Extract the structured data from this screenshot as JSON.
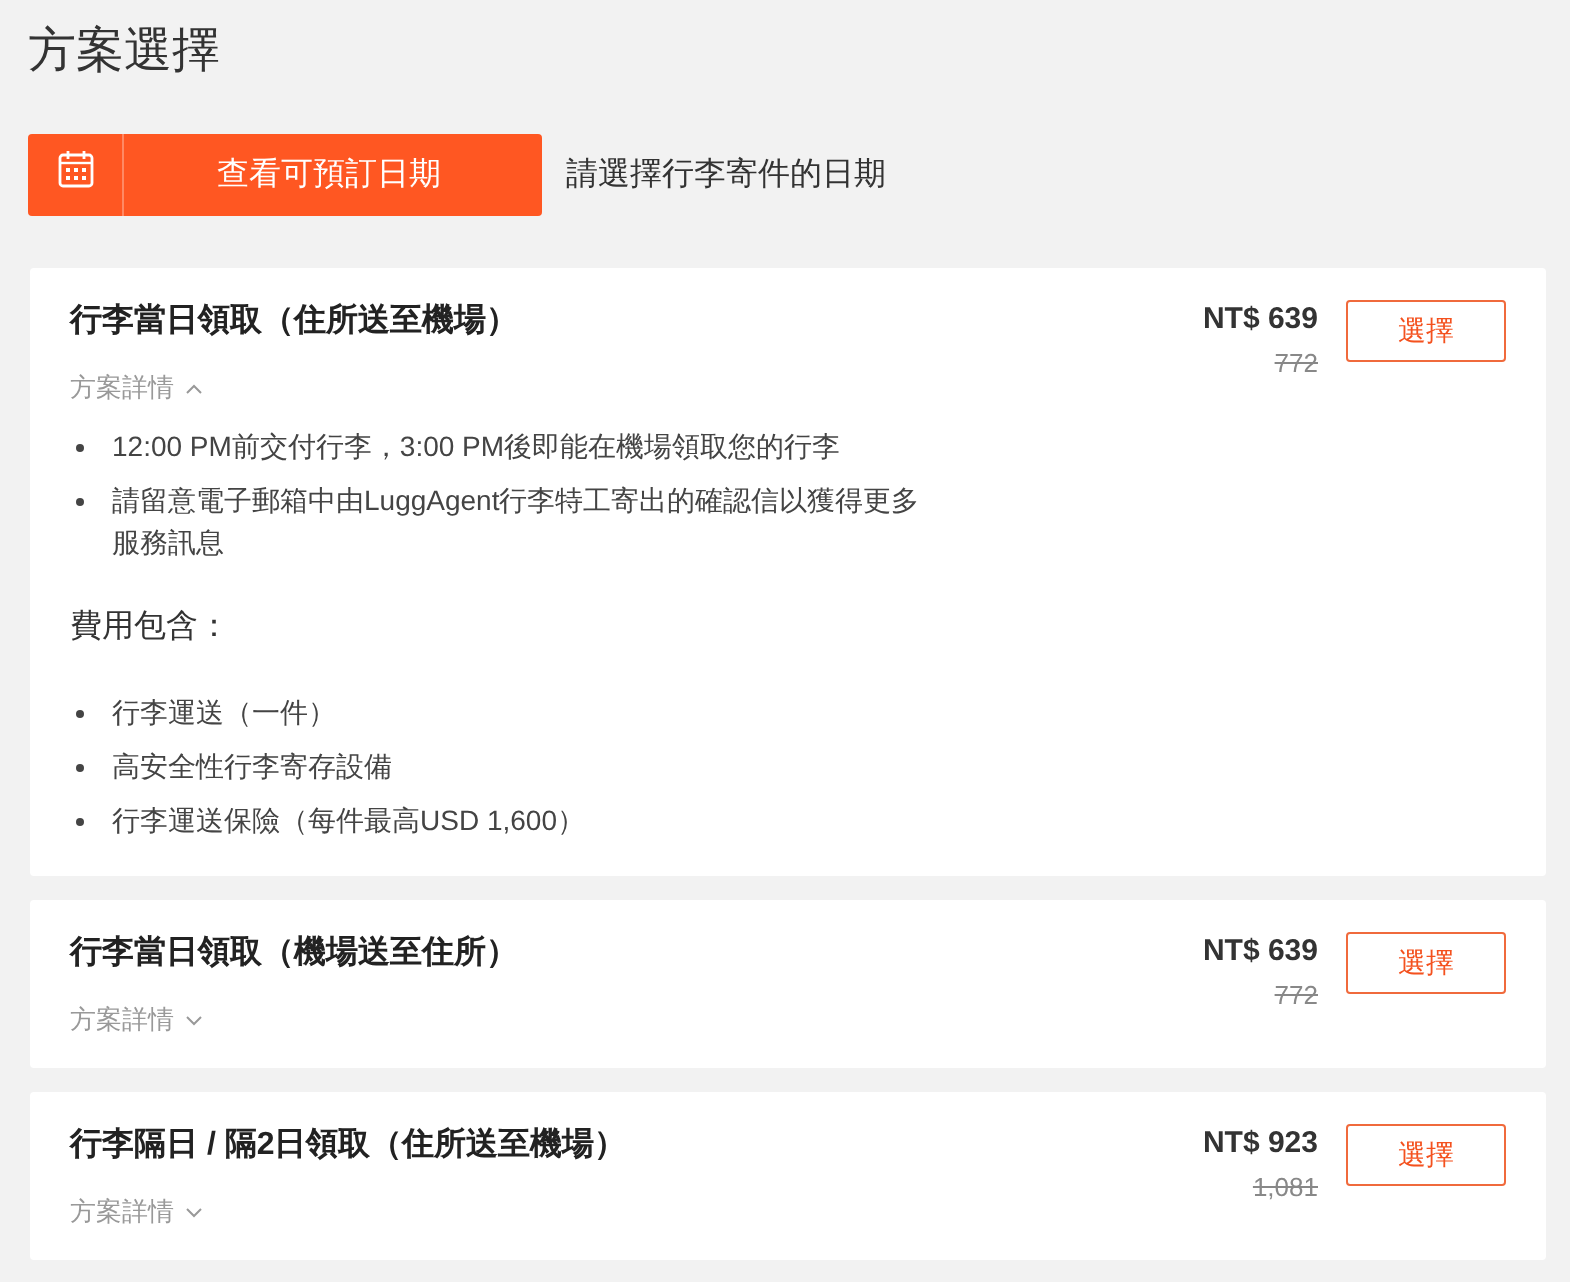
{
  "page_title": "方案選擇",
  "date_bar": {
    "button": "查看可預訂日期",
    "hint": "請選擇行李寄件的日期"
  },
  "plans": [
    {
      "name": "行李當日領取（住所送至機場）",
      "details_label": "方案詳情",
      "expanded": true,
      "price": "NT$ 639",
      "original_price": "772",
      "select_label": "選擇",
      "notes": [
        "12:00 PM前交付行李，3:00 PM後即能在機場領取您的行李",
        "請留意電子郵箱中由LuggAgent行李特工寄出的確認信以獲得更多服務訊息"
      ],
      "includes_title": "費用包含：",
      "includes": [
        "行李運送（一件）",
        "高安全性行李寄存設備",
        "行李運送保險（每件最高USD 1,600）"
      ]
    },
    {
      "name": "行李當日領取（機場送至住所）",
      "details_label": "方案詳情",
      "expanded": false,
      "price": "NT$ 639",
      "original_price": "772",
      "select_label": "選擇"
    },
    {
      "name": "行李隔日 / 隔2日領取（住所送至機場）",
      "details_label": "方案詳情",
      "expanded": false,
      "price": "NT$ 923",
      "original_price": "1,081",
      "select_label": "選擇"
    }
  ]
}
